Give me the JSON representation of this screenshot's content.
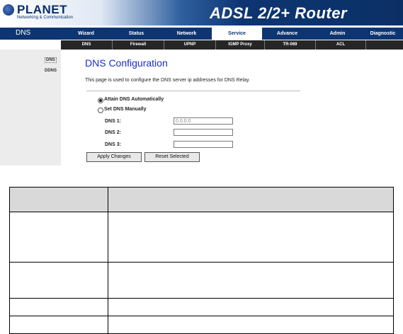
{
  "header": {
    "brand": "PLANET",
    "brand_tagline": "Networking & Communication",
    "product_title": "ADSL 2/2+ Router"
  },
  "nav": {
    "current_section": "DNS",
    "tabs": [
      {
        "label": "Wizard"
      },
      {
        "label": "Status"
      },
      {
        "label": "Network"
      },
      {
        "label": "Service",
        "active": true
      },
      {
        "label": "Advance"
      },
      {
        "label": "Admin"
      },
      {
        "label": "Diagnostic"
      }
    ],
    "subtabs": [
      {
        "label": "DNS"
      },
      {
        "label": "Firewall"
      },
      {
        "label": "UPNP"
      },
      {
        "label": "IGMP Proxy"
      },
      {
        "label": "TR-069"
      },
      {
        "label": "ACL"
      }
    ]
  },
  "sidebar": {
    "items": [
      {
        "label": "DNS",
        "selected": true
      },
      {
        "label": "DDNS"
      }
    ]
  },
  "main": {
    "title": "DNS Configuration",
    "description": "This page is used to configure the DNS server ip addresses for DNS Relay.",
    "option_auto": "Attain DNS Automatically",
    "option_manual": "Set DNS Manually",
    "selected_option": "auto",
    "fields": [
      {
        "label": "DNS 1:",
        "value": "0.0.0.0"
      },
      {
        "label": "DNS 2:",
        "value": ""
      },
      {
        "label": "DNS 3:",
        "value": ""
      }
    ],
    "apply_button": "Apply Changes",
    "reset_button": "Reset Selected"
  },
  "colors": {
    "nav_bg": "#0d3572",
    "subnav_bg": "#262626",
    "title_blue": "#1a2ccc",
    "sidebar_bg": "#ececec"
  }
}
